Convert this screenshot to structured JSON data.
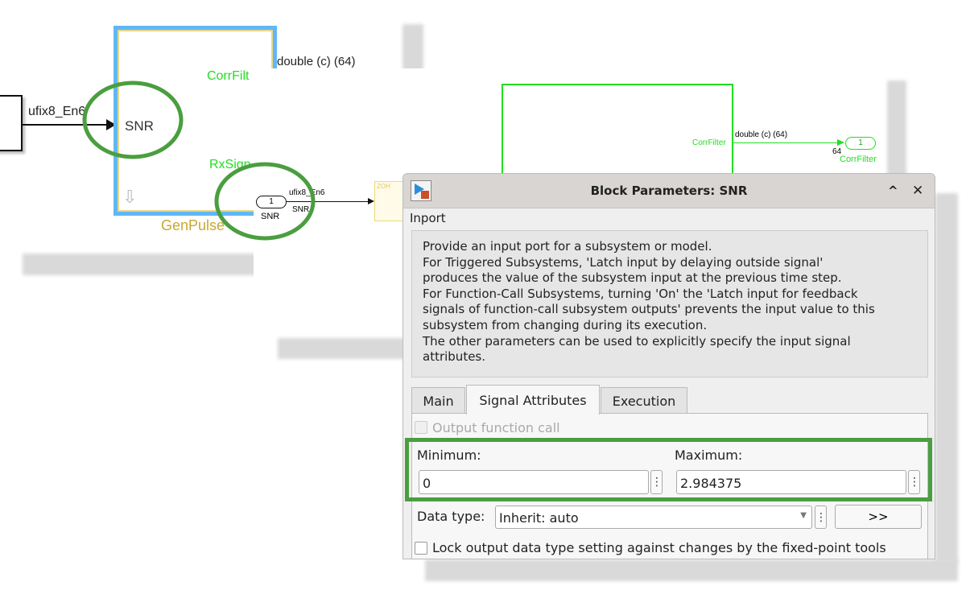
{
  "back_model": {
    "signal_in_label": "ufix8_En6",
    "subsystem_name": "GenPulse",
    "port_in": "SNR",
    "port_out_1": "CorrFilt",
    "port_out_2": "RxSign",
    "out_signal_label": "double (c) (64)"
  },
  "mid_model": {
    "inport_number": "1",
    "inport_name": "SNR",
    "signal_label": "ufix8_En6",
    "signal_name": "SNR",
    "zoh_label": "ZOH",
    "subsystem_port": "CorrFilter",
    "out_signal_label": "double (c) (64)",
    "outport_number": "1",
    "outport_width": "64",
    "outport_name": "CorrFilter"
  },
  "dialog": {
    "title": "Block Parameters: SNR",
    "block_type": "Inport",
    "description": [
      "Provide an input port for a subsystem or model.",
      "For Triggered Subsystems, 'Latch input by delaying outside signal'",
      "produces the value of the subsystem input at the previous time step.",
      "For Function-Call Subsystems, turning 'On' the 'Latch input for feedback",
      "signals of function-call subsystem outputs' prevents the input value to this",
      "subsystem from changing during its execution.",
      "The other parameters can be used to explicitly specify the input signal",
      "attributes."
    ],
    "tabs": [
      {
        "label": "Main"
      },
      {
        "label": "Signal Attributes",
        "active": true
      },
      {
        "label": "Execution"
      }
    ],
    "output_function_call": {
      "label": "Output function call",
      "checked": false,
      "enabled": false
    },
    "minimum": {
      "label": "Minimum:",
      "value": "0"
    },
    "maximum": {
      "label": "Maximum:",
      "value": "2.984375"
    },
    "data_type": {
      "label": "Data type:",
      "value": "Inherit: auto",
      "assistant_button": ">>"
    },
    "lock_output": {
      "label": "Lock output data type setting against changes by the fixed-point tools",
      "checked": false
    },
    "dots": "⋮",
    "collapse_icon": "^",
    "close_icon": "✕"
  },
  "colors": {
    "highlight": "#4a9e3f",
    "port_green": "#22dd22",
    "subsystem_blue": "#5fb8f5",
    "subsystem_yellow": "#e8d58a"
  }
}
